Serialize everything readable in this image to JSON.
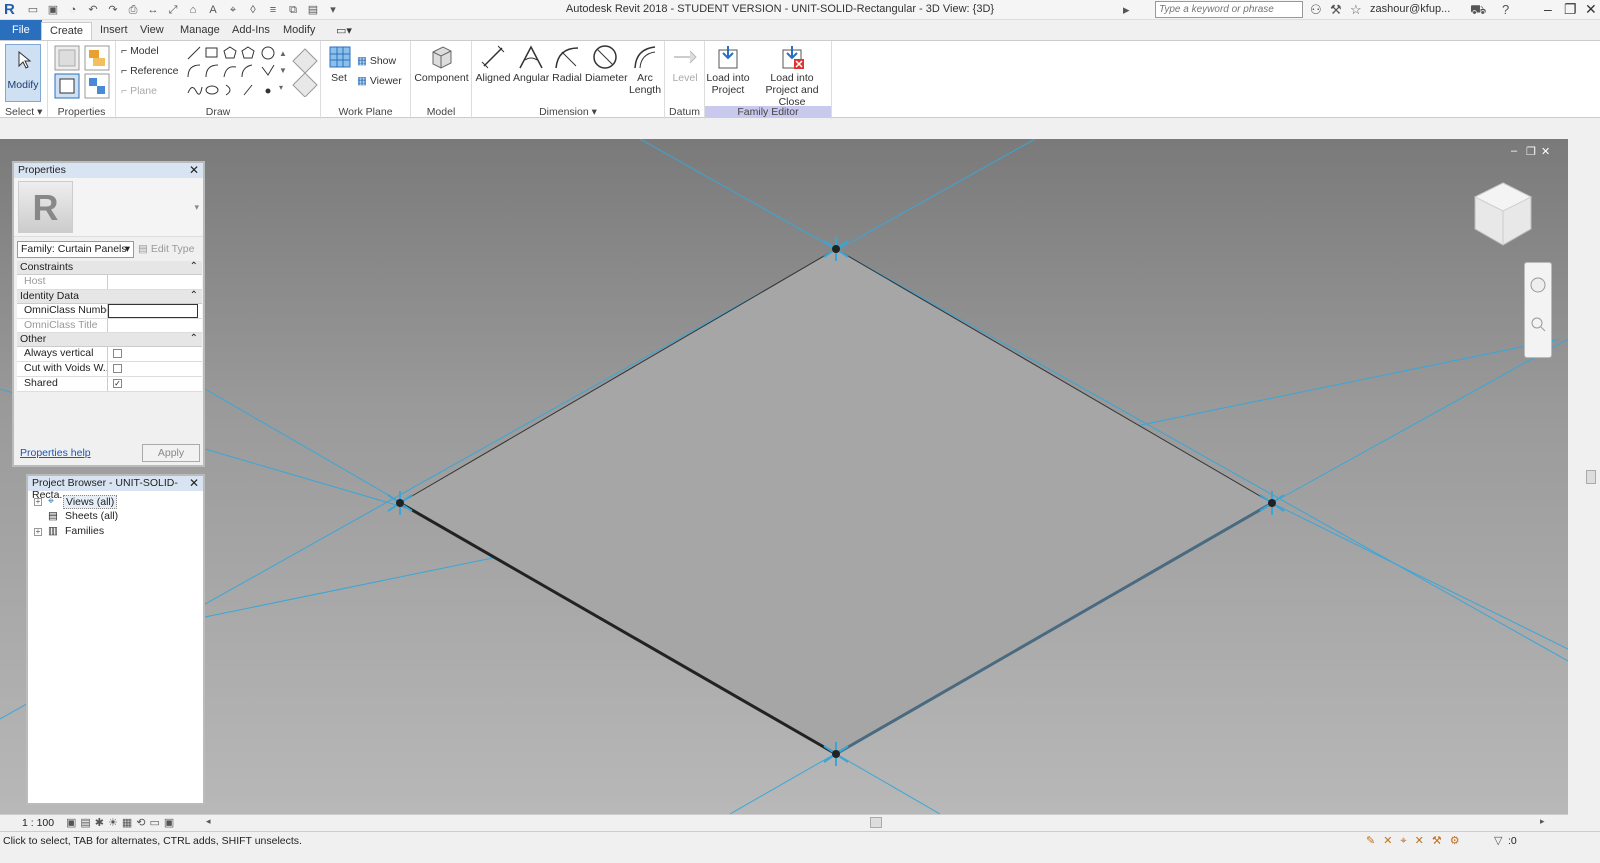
{
  "titlebar": {
    "app_title": "Autodesk Revit 2018 - STUDENT VERSION -    UNIT-SOLID-Rectangular - 3D View: {3D}",
    "search_placeholder": "Type a keyword or phrase",
    "user": "zashour@kfup...",
    "help": "?"
  },
  "menu": {
    "file": "File",
    "tabs": [
      "Create",
      "Insert",
      "View",
      "Manage",
      "Add-Ins",
      "Modify"
    ]
  },
  "ribbon": {
    "select": {
      "modify": "Modify",
      "label": "Select"
    },
    "properties": {
      "label": "Properties"
    },
    "draw": {
      "model": "Model",
      "reference": "Reference",
      "plane": "Plane",
      "label": "Draw"
    },
    "work_plane": {
      "set": "Set",
      "show": "Show",
      "viewer": "Viewer",
      "label": "Work Plane"
    },
    "model": {
      "component": "Component",
      "label": "Model"
    },
    "dimension": {
      "aligned": "Aligned",
      "angular": "Angular",
      "radial": "Radial",
      "diameter": "Diameter",
      "arc_length_1": "Arc",
      "arc_length_2": "Length",
      "label": "Dimension"
    },
    "datum": {
      "level": "Level",
      "label": "Datum"
    },
    "family_editor": {
      "load_1": "Load into",
      "load_2": "Project",
      "load_close_1": "Load into",
      "load_close_2": "Project and Close",
      "label": "Family Editor"
    }
  },
  "properties": {
    "title": "Properties",
    "family": "Family: Curtain Panels",
    "edit_type": "Edit Type",
    "groups": {
      "constraints": "Constraints",
      "identity": "Identity Data",
      "other": "Other"
    },
    "rows": {
      "host": "Host",
      "omniclass_number": "OmniClass Number",
      "omniclass_title": "OmniClass Title",
      "always_vertical": "Always vertical",
      "cut_with_voids": "Cut with Voids W...",
      "shared": "Shared"
    },
    "checks": {
      "always_vertical": false,
      "cut_with_voids": false,
      "shared": true
    },
    "help": "Properties help",
    "apply": "Apply"
  },
  "browser": {
    "title": "Project Browser - UNIT-SOLID-Recta...",
    "items": [
      "Views (all)",
      "Sheets (all)",
      "Families"
    ]
  },
  "viewbar": {
    "scale": "1 : 100"
  },
  "status": {
    "text": "Click to select, TAB for alternates, CTRL adds, SHIFT unselects.",
    "filter": ":0"
  },
  "colors": {
    "accent": "#2a6fbe",
    "ref_line": "#3aa6d8",
    "family_editor": "#c9c9ee"
  }
}
